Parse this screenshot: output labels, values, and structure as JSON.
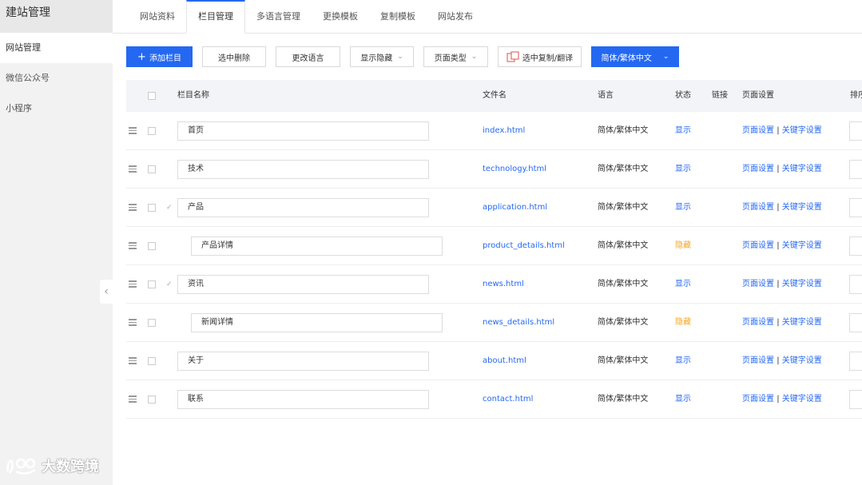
{
  "sidebar": {
    "title": "建站管理",
    "items": [
      {
        "label": "网站管理",
        "active": true
      },
      {
        "label": "微信公众号",
        "active": false
      },
      {
        "label": "小程序",
        "active": false
      }
    ]
  },
  "tabs": [
    {
      "label": "网站资料",
      "active": false
    },
    {
      "label": "栏目管理",
      "active": true
    },
    {
      "label": "多语言管理",
      "active": false
    },
    {
      "label": "更换模板",
      "active": false
    },
    {
      "label": "复制模板",
      "active": false
    },
    {
      "label": "网站发布",
      "active": false
    }
  ],
  "toolbar": {
    "add_label": "添加栏目",
    "delete_label": "选中删除",
    "change_lang_label": "更改语言",
    "show_hide_label": "显示隐藏",
    "page_type_label": "页面类型",
    "copy_translate_label": "选中复制/翻译",
    "lang_select_label": "简体/繁体中文"
  },
  "table": {
    "headers": {
      "name": "栏目名称",
      "file": "文件名",
      "lang": "语言",
      "status": "状态",
      "link": "链接",
      "page_settings": "页面设置",
      "sort": "排序"
    },
    "rows": [
      {
        "name": "首页",
        "file": "index.html",
        "lang": "简体/繁体中文",
        "status": "显示",
        "page_setting": "页面设置",
        "keyword_setting": "关键字设置",
        "sep": "|"
      },
      {
        "name": "技术",
        "file": "technology.html",
        "lang": "简体/繁体中文",
        "status": "显示",
        "page_setting": "页面设置",
        "keyword_setting": "关键字设置",
        "sep": "|"
      },
      {
        "name": "产品",
        "file": "application.html",
        "lang": "简体/繁体中文",
        "status": "显示",
        "page_setting": "页面设置",
        "keyword_setting": "关键字设置",
        "sep": "|"
      },
      {
        "name": "产品详情",
        "file": "product_details.html",
        "lang": "简体/繁体中文",
        "status": "隐藏",
        "page_setting": "页面设置",
        "keyword_setting": "关键字设置",
        "sep": "|"
      },
      {
        "name": "资讯",
        "file": "news.html",
        "lang": "简体/繁体中文",
        "status": "显示",
        "page_setting": "页面设置",
        "keyword_setting": "关键字设置",
        "sep": "|"
      },
      {
        "name": "新闻详情",
        "file": "news_details.html",
        "lang": "简体/繁体中文",
        "status": "隐藏",
        "page_setting": "页面设置",
        "keyword_setting": "关键字设置",
        "sep": "|"
      },
      {
        "name": "关于",
        "file": "about.html",
        "lang": "简体/繁体中文",
        "status": "显示",
        "page_setting": "页面设置",
        "keyword_setting": "关键字设置",
        "sep": "|"
      },
      {
        "name": "联系",
        "file": "contact.html",
        "lang": "简体/繁体中文",
        "status": "显示",
        "page_setting": "页面设置",
        "keyword_setting": "关键字设置",
        "sep": "|"
      }
    ]
  },
  "watermark": {
    "text": "大数跨境"
  },
  "colors": {
    "primary": "#2468f2",
    "hidden": "#f5a623",
    "sidebar_bg": "#f2f2f2",
    "header_bg": "#f3f4f7"
  },
  "icons": {
    "add": "plus-icon",
    "drag": "drag-handle-icon",
    "caret": "chevron-down-icon",
    "collapse": "chevron-left-icon",
    "copy": "copy-translate-icon"
  }
}
